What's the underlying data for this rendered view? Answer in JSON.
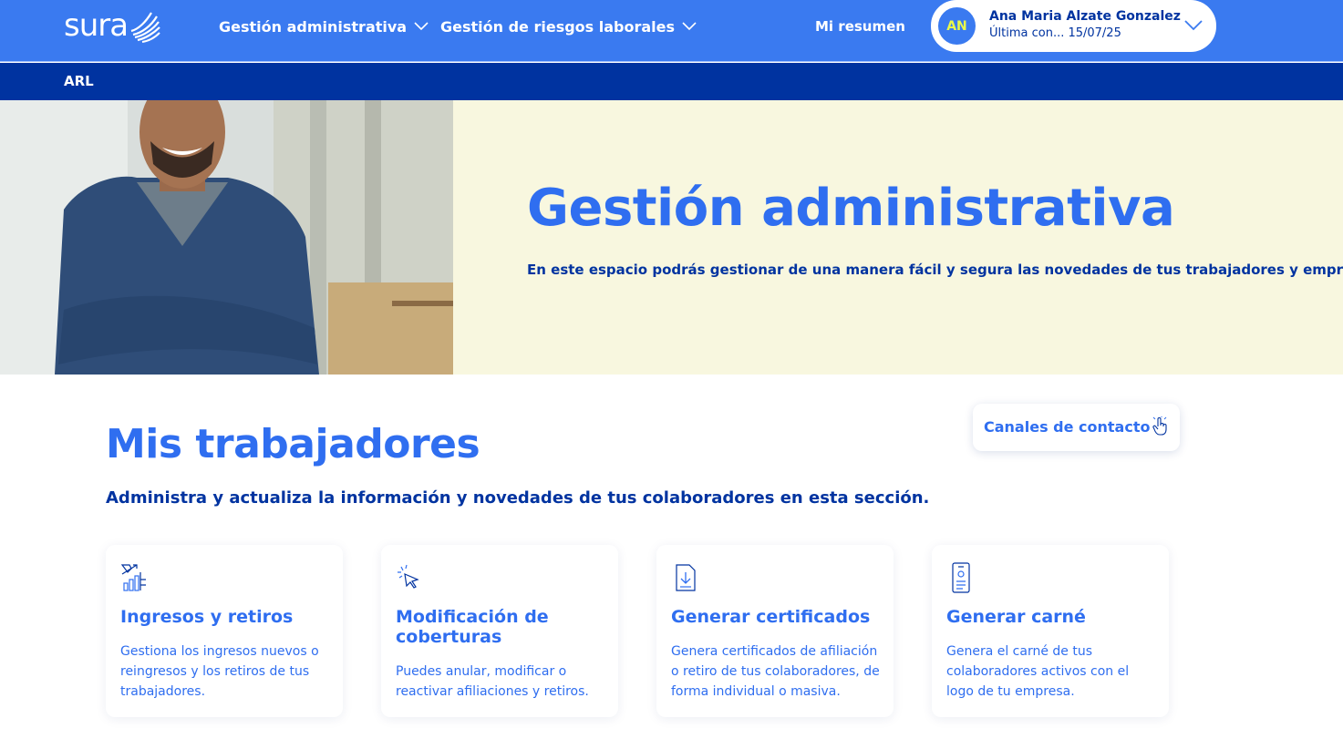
{
  "brand": {
    "logo_text": "sura"
  },
  "colors": {
    "primary": "#3a7af0",
    "dark_blue": "#0033a0",
    "accent_yellow": "#e9f94a",
    "hero_bg": "#f8f7df"
  },
  "nav": {
    "items": [
      {
        "label": "Gestión administrativa"
      },
      {
        "label": "Gestión de riesgos laborales"
      },
      {
        "label": "Mi resumen"
      }
    ]
  },
  "user": {
    "initials": "AN",
    "name": "Ana Maria Alzate Gonzalez",
    "last_connection": "Última con... 15/07/25"
  },
  "subbar": {
    "label": "ARL"
  },
  "hero": {
    "title": "Gestión administrativa",
    "subtitle": "En este espacio podrás gestionar de una manera fácil y segura las novedades de tus trabajadores y empresa."
  },
  "contact": {
    "label": "Canales de contacto",
    "icon": "hand-pointer-icon"
  },
  "section": {
    "title": "Mis trabajadores",
    "subtitle": "Administra y actualiza la información y novedades de tus colaboradores en esta sección."
  },
  "cards": [
    {
      "icon": "chart-growth-icon",
      "title": "Ingresos y retiros",
      "description": "Gestiona los ingresos nuevos o reingresos y los retiros de tus trabajadores."
    },
    {
      "icon": "cursor-click-icon",
      "title": "Modificación de coberturas",
      "description": "Puedes anular, modificar o reactivar afiliaciones y retiros."
    },
    {
      "icon": "document-download-icon",
      "title": "Generar certificados",
      "description": "Genera certificados de afiliación o retiro de tus colaboradores, de forma individual o masiva."
    },
    {
      "icon": "id-card-icon",
      "title": "Generar carné",
      "description": "Genera el carné de tus colaboradores activos con el logo de tu empresa."
    }
  ]
}
